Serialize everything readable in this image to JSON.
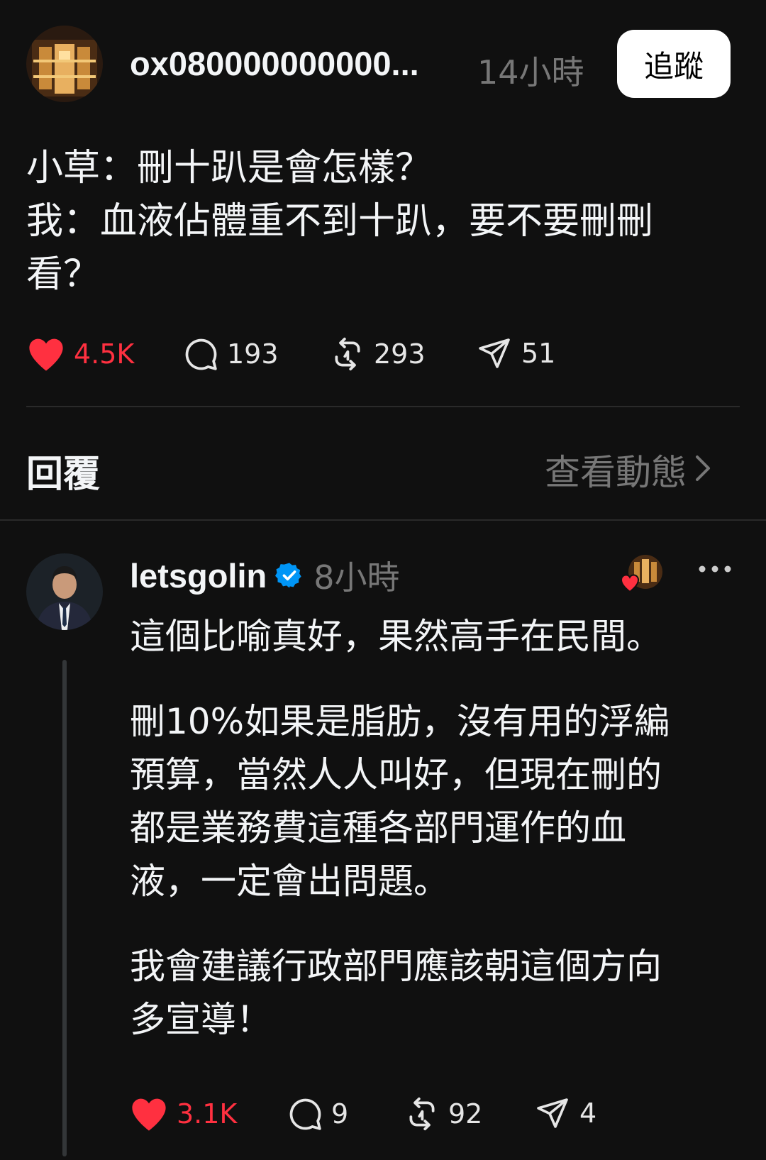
{
  "post": {
    "username": "ox080000000000...",
    "time": "14小時",
    "follow_label": "追蹤",
    "lines": [
      "小草：刪十趴是會怎樣？",
      "我：血液佔體重不到十趴，要不要刪刪",
      "看？"
    ],
    "likes": "4.5K",
    "comments": "193",
    "reposts": "293",
    "shares": "51"
  },
  "replies_header": {
    "label": "回覆",
    "view_activity": "查看動態"
  },
  "reply": {
    "username": "letsgolin",
    "time": "8小時",
    "paragraphs": [
      [
        "這個比喻真好，果然高手在民間。"
      ],
      [
        "刪10%如果是脂肪，沒有用的浮編",
        "預算，當然人人叫好，但現在刪的",
        "都是業務費這種各部門運作的血",
        "液，一定會出問題。"
      ],
      [
        "我會建議行政部門應該朝這個方向",
        "多宣導！"
      ]
    ],
    "likes": "3.1K",
    "comments": "9",
    "reposts": "92",
    "shares": "4"
  },
  "colors": {
    "background": "#101010",
    "like_red": "#ff3040",
    "verified_blue": "#0095f6",
    "muted": "#777777"
  },
  "icons": [
    "heart-icon",
    "comment-icon",
    "repost-icon",
    "share-icon",
    "verified-icon",
    "chevron-right-icon",
    "more-icon"
  ]
}
